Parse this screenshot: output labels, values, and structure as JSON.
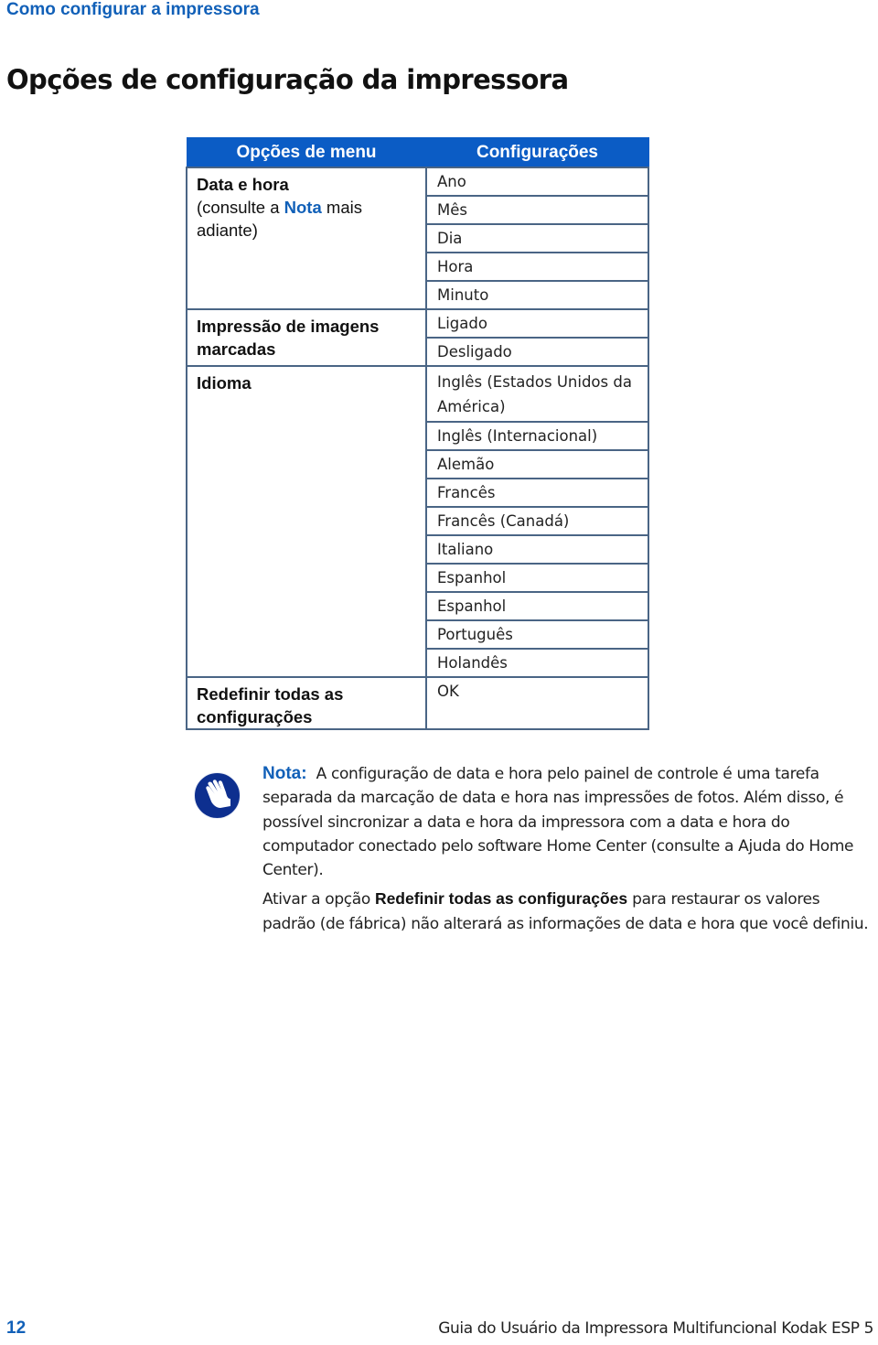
{
  "header": {
    "running_head": "Como configurar a impressora",
    "page_title": "Opções de configuração da impressora"
  },
  "table": {
    "headers": [
      "Opções de menu",
      "Configurações"
    ],
    "groups": [
      {
        "menu_option": "Data e hora",
        "menu_note_prefix": "(consulte a ",
        "menu_note_link": "Nota",
        "menu_note_suffix": " mais adiante)",
        "settings": [
          "Ano",
          "Mês",
          "Dia",
          "Hora",
          "Minuto"
        ]
      },
      {
        "menu_option": "Impressão de imagens marcadas",
        "settings": [
          "Ligado",
          "Desligado"
        ]
      },
      {
        "menu_option": "Idioma",
        "settings": [
          "Inglês (Estados Unidos da América)",
          "Inglês (Internacional)",
          "Alemão",
          "Francês",
          "Francês (Canadá)",
          "Italiano",
          "Espanhol",
          "Espanhol",
          "Português",
          "Holandês"
        ]
      },
      {
        "menu_option": "Redefinir todas as configurações",
        "settings": [
          "OK"
        ]
      }
    ]
  },
  "note": {
    "icon": "hand-stop-icon",
    "label": "Nota:",
    "paragraph1": "A configuração de data e hora pelo painel de controle é uma tarefa separada da marcação de data e hora nas impressões de fotos. Além disso, é possível sincronizar a data e hora da impressora com a data e hora do computador conectado pelo software Home Center (consulte a Ajuda do Home Center).",
    "paragraph2_prefix": "Ativar a opção ",
    "paragraph2_bold": "Redefinir todas as configurações",
    "paragraph2_suffix": " para restaurar os valores padrão (de fábrica) não alterará as informações de data e hora que você definiu."
  },
  "footer": {
    "page_number": "12",
    "document_title": "Guia do Usuário da Impressora Multifuncional Kodak ESP 5"
  },
  "colors": {
    "accent_blue": "#1160b8",
    "table_header_blue": "#0b5cc5",
    "table_border": "#4a6585"
  }
}
